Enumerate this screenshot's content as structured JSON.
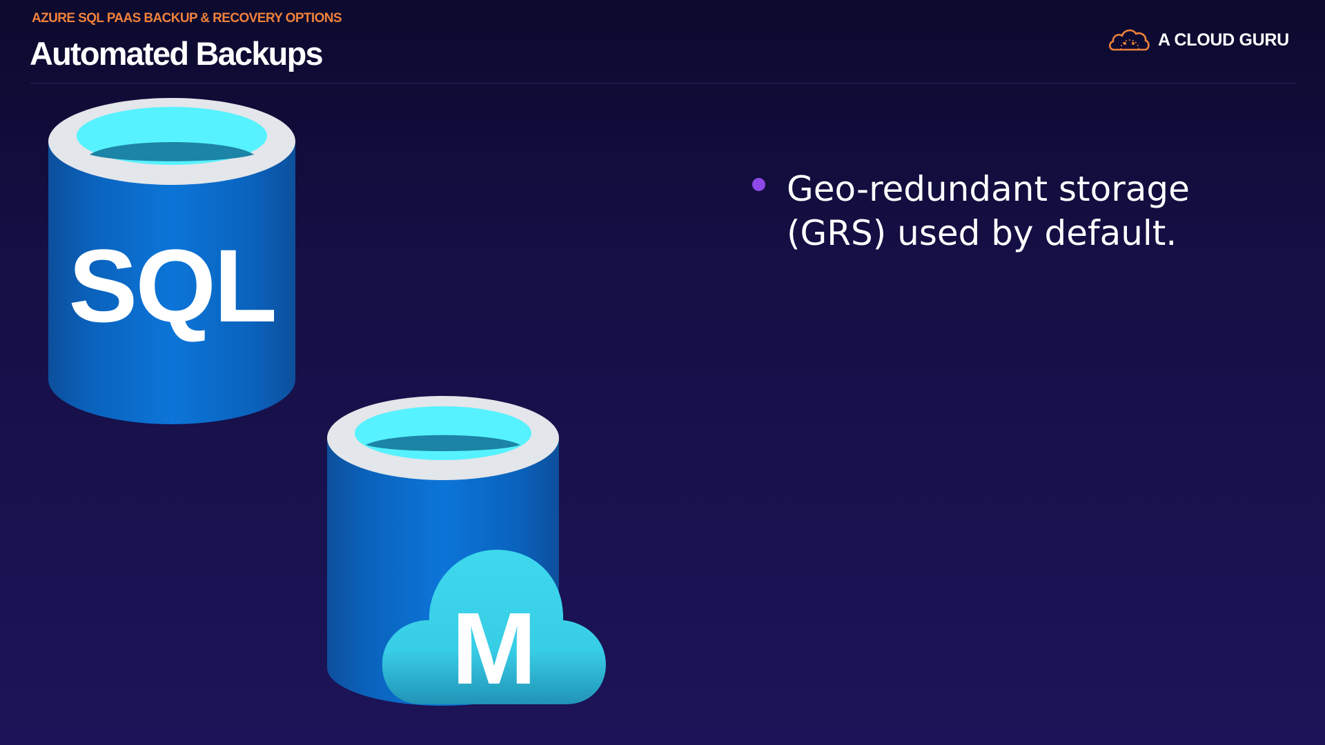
{
  "header": {
    "eyebrow": "AZURE SQL PAAS BACKUP & RECOVERY OPTIONS",
    "title": "Automated Backups"
  },
  "brand": {
    "name": "A CLOUD GURU",
    "logo_icon": "cloud-logo-icon",
    "accent_color": "#f0823a"
  },
  "content": {
    "bullets": [
      {
        "text": "Geo-redundant storage (GRS) used by default."
      }
    ]
  },
  "icons": {
    "sql_database": {
      "icon": "sql-database-icon",
      "label": "SQL"
    },
    "managed_instance": {
      "icon": "sql-managed-instance-icon",
      "label": "M"
    }
  },
  "colors": {
    "background": "#150f45",
    "bullet": "#8f48e8",
    "database_blue": "#0a6fd0",
    "database_top": "#57f2ff",
    "cloud": "#3ed3e8"
  }
}
